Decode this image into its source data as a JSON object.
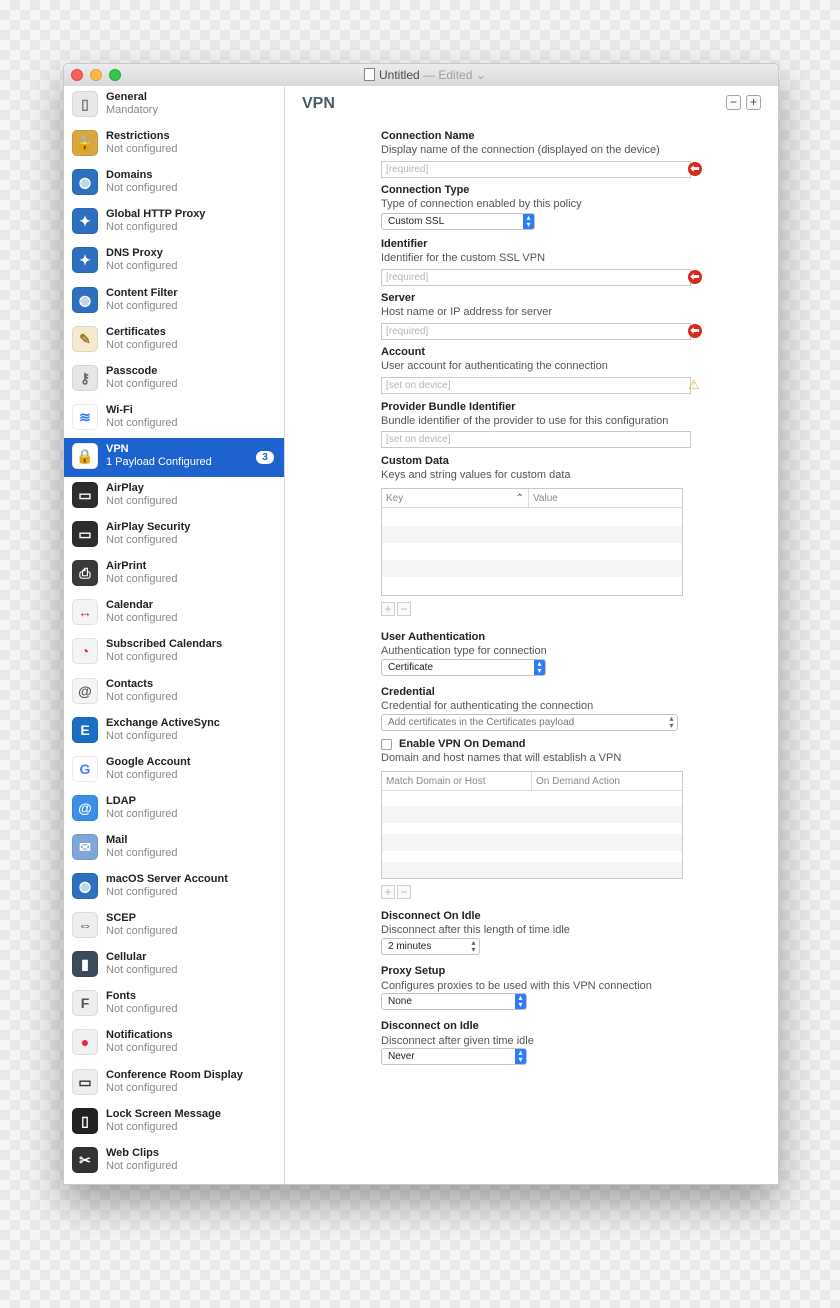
{
  "window": {
    "title": "Untitled",
    "edited": "— Edited",
    "close_color": "#fc605c",
    "minimize_color": "#fdbc40",
    "zoom_color": "#34c84a"
  },
  "sidebar": {
    "selected_color": "#1e62d0",
    "items": [
      {
        "name": "General",
        "status": "Mandatory",
        "icon": "switch-icon"
      },
      {
        "name": "Restrictions",
        "status": "Not configured",
        "icon": "padlock-icon"
      },
      {
        "name": "Domains",
        "status": "Not configured",
        "icon": "globe-icon"
      },
      {
        "name": "Global HTTP Proxy",
        "status": "Not configured",
        "icon": "globe-compass-icon"
      },
      {
        "name": "DNS Proxy",
        "status": "Not configured",
        "icon": "globe-compass-icon"
      },
      {
        "name": "Content Filter",
        "status": "Not configured",
        "icon": "globe-filter-icon"
      },
      {
        "name": "Certificates",
        "status": "Not configured",
        "icon": "certificate-icon"
      },
      {
        "name": "Passcode",
        "status": "Not configured",
        "icon": "key-icon"
      },
      {
        "name": "Wi-Fi",
        "status": "Not configured",
        "icon": "wifi-icon"
      },
      {
        "name": "VPN",
        "status": "1 Payload Configured",
        "icon": "vpn-lock-icon",
        "badge": "3",
        "selected": true
      },
      {
        "name": "AirPlay",
        "status": "Not configured",
        "icon": "airplay-icon"
      },
      {
        "name": "AirPlay Security",
        "status": "Not configured",
        "icon": "airplay-lock-icon"
      },
      {
        "name": "AirPrint",
        "status": "Not configured",
        "icon": "printer-icon"
      },
      {
        "name": "Calendar",
        "status": "Not configured",
        "icon": "calendar-icon"
      },
      {
        "name": "Subscribed Calendars",
        "status": "Not configured",
        "icon": "calendar-rss-icon"
      },
      {
        "name": "Contacts",
        "status": "Not configured",
        "icon": "contacts-icon"
      },
      {
        "name": "Exchange ActiveSync",
        "status": "Not configured",
        "icon": "exchange-icon"
      },
      {
        "name": "Google Account",
        "status": "Not configured",
        "icon": "google-icon"
      },
      {
        "name": "LDAP",
        "status": "Not configured",
        "icon": "ldap-icon"
      },
      {
        "name": "Mail",
        "status": "Not configured",
        "icon": "mail-icon"
      },
      {
        "name": "macOS Server Account",
        "status": "Not configured",
        "icon": "server-globe-icon"
      },
      {
        "name": "SCEP",
        "status": "Not configured",
        "icon": "scep-icon"
      },
      {
        "name": "Cellular",
        "status": "Not configured",
        "icon": "cellular-icon"
      },
      {
        "name": "Fonts",
        "status": "Not configured",
        "icon": "font-icon"
      },
      {
        "name": "Notifications",
        "status": "Not configured",
        "icon": "notification-icon"
      },
      {
        "name": "Conference Room Display",
        "status": "Not configured",
        "icon": "display-lock-icon"
      },
      {
        "name": "Lock Screen Message",
        "status": "Not configured",
        "icon": "phone-lock-icon"
      },
      {
        "name": "Web Clips",
        "status": "Not configured",
        "icon": "web-clip-icon"
      }
    ]
  },
  "main": {
    "title": "VPN",
    "remove_label": "−",
    "add_label": "+",
    "connection_name": {
      "label": "Connection Name",
      "description": "Display name of the connection (displayed on the device)",
      "placeholder": "[required]"
    },
    "connection_type": {
      "label": "Connection Type",
      "description": "Type of connection enabled by this policy",
      "value": "Custom SSL"
    },
    "identifier": {
      "label": "Identifier",
      "description": "Identifier for the custom SSL VPN",
      "placeholder": "[required]"
    },
    "server": {
      "label": "Server",
      "description": "Host name or IP address for server",
      "placeholder": "[required]"
    },
    "account": {
      "label": "Account",
      "description": "User account for authenticating the connection",
      "placeholder": "[set on device]"
    },
    "provider_bundle": {
      "label": "Provider Bundle Identifier",
      "description": "Bundle identifier of the provider to use for this configuration",
      "placeholder": "[set on device]"
    },
    "custom_data": {
      "label": "Custom Data",
      "description": "Keys and string values for custom data",
      "col_key": "Key",
      "col_value": "Value",
      "add": "+",
      "remove": "−"
    },
    "user_auth": {
      "label": "User Authentication",
      "description": "Authentication type for connection",
      "value": "Certificate"
    },
    "credential": {
      "label": "Credential",
      "description": "Credential for authenticating the connection",
      "value": "Add certificates in the Certificates payload"
    },
    "vpn_on_demand": {
      "label": "Enable VPN On Demand",
      "description": "Domain and host names that will establish a VPN",
      "checked": false,
      "col_match": "Match Domain or Host",
      "col_action": "On Demand Action",
      "add": "+",
      "remove": "−"
    },
    "disconnect_idle": {
      "label": "Disconnect On Idle",
      "description": "Disconnect after this length of time idle",
      "value": "2 minutes"
    },
    "proxy_setup": {
      "label": "Proxy Setup",
      "description": "Configures proxies to be used with this VPN connection",
      "value": "None"
    },
    "disconnect_idle2": {
      "label": "Disconnect on Idle",
      "description": "Disconnect after given time idle",
      "value": "Never"
    },
    "error_color": "#d52a1e",
    "warning_color": "#e5b52a",
    "popup_accent": "#2e7cf6"
  }
}
